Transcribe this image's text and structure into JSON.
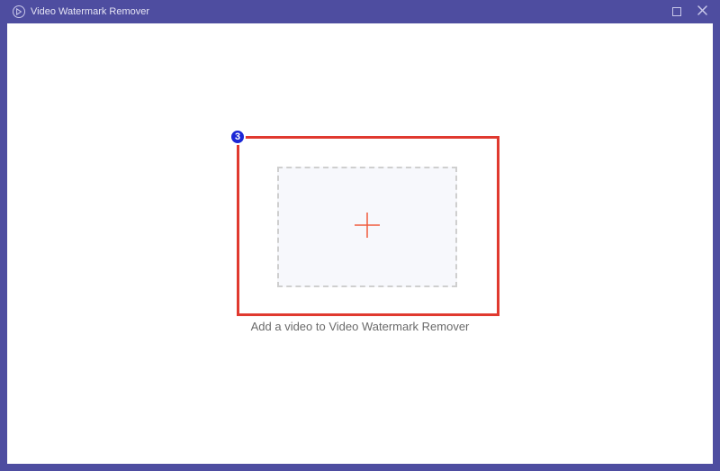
{
  "window": {
    "title": "Video Watermark Remover"
  },
  "main": {
    "drop_caption": "Add a video to Video Watermark Remover",
    "step_number": "3"
  },
  "icons": {
    "app": "app-logo-icon",
    "minimize": "minimize-icon",
    "close": "close-icon",
    "plus": "plus-icon"
  },
  "colors": {
    "titlebar": "#4e4da0",
    "highlight": "#e0392f",
    "badge": "#1b27d6",
    "plus": "#f05a3c",
    "dropzone_bg": "#f7f8fc",
    "dropzone_border": "#cfcfcf"
  }
}
